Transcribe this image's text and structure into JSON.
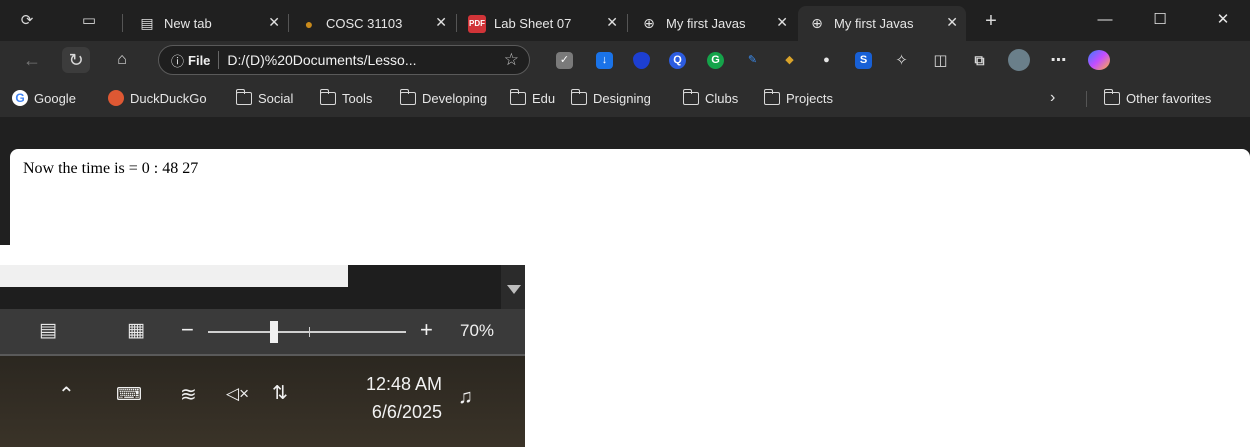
{
  "tabs": [
    {
      "title": "New tab",
      "icon": "newtab-icon",
      "active": false
    },
    {
      "title": "COSC 31103",
      "icon": "course-icon",
      "active": false
    },
    {
      "title": "Lab Sheet 07",
      "icon": "pdf-icon",
      "active": false
    },
    {
      "title": "My first Javas",
      "icon": "globe-icon",
      "active": false
    },
    {
      "title": "My first Javas",
      "icon": "globe-icon",
      "active": true
    }
  ],
  "tab_close_glyph": "✕",
  "new_tab_glyph": "+",
  "address_bar": {
    "info_label": "File",
    "url": "D:/(D)%20Documents/Lesso..."
  },
  "favorites": [
    {
      "label": "Google",
      "icon": "google-icon"
    },
    {
      "label": "DuckDuckGo",
      "icon": "duckduckgo-icon"
    },
    {
      "label": "Social",
      "icon": "folder-icon"
    },
    {
      "label": "Tools",
      "icon": "folder-icon"
    },
    {
      "label": "Developing",
      "icon": "folder-icon"
    },
    {
      "label": "Edu",
      "icon": "folder-icon"
    },
    {
      "label": "Designing",
      "icon": "folder-icon"
    },
    {
      "label": "Clubs",
      "icon": "folder-icon"
    },
    {
      "label": "Projects",
      "icon": "folder-icon"
    }
  ],
  "other_favorites": "Other favorites",
  "page_content": "Now the time is = 0 : 48 27",
  "zoom": {
    "level_label": "70%",
    "minus": "−",
    "plus": "+"
  },
  "clock": {
    "time": "12:48 AM",
    "date": "6/6/2025"
  },
  "colors": {
    "titlebar": "#202020",
    "toolbar": "#2d2d2d",
    "pdf_red": "#d13438",
    "course_orange": "#c98a1b"
  }
}
